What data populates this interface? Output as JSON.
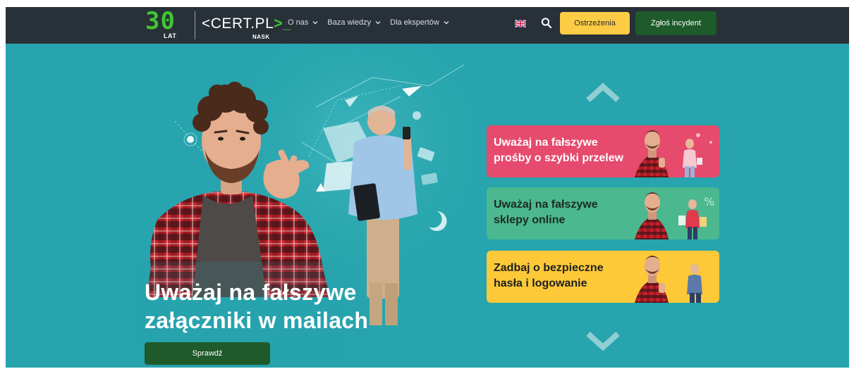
{
  "logo": {
    "anniversary_number": "30",
    "anniversary_label": "LAT",
    "brand_prefix": "<",
    "brand_name": "CERT.PL",
    "brand_suffix": ">_",
    "sub_brand": "NASK"
  },
  "nav": {
    "items": [
      {
        "label": "O nas"
      },
      {
        "label": "Baza wiedzy"
      },
      {
        "label": "Dla ekspertów"
      }
    ],
    "flag_icon": "uk-flag-icon",
    "search_icon": "search-icon"
  },
  "buttons": {
    "warnings": "Ostrzeżenia",
    "report": "Zgłoś incydent"
  },
  "hero": {
    "title_line1": "Uważaj na fałszywe",
    "title_line2": "załączniki w mailach",
    "cta": "Sprawdź"
  },
  "carousel": {
    "cards": [
      {
        "line1": "Uważaj na fałszywe",
        "line2": "prośby o szybki przelew"
      },
      {
        "line1": "Uważaj na fałszywe",
        "line2": "sklepy online"
      },
      {
        "line1": "Zadbaj o bezpieczne",
        "line2": "hasła i logowanie"
      }
    ]
  },
  "colors": {
    "navbar": "#283038",
    "background": "#27a4ad",
    "brand_green": "#3fc534",
    "warning_yellow": "#fdcc45",
    "dark_green": "#1e5a2a",
    "card_pink": "#e64a6c",
    "card_green": "#4bb890",
    "card_yellow": "#fdc939"
  }
}
